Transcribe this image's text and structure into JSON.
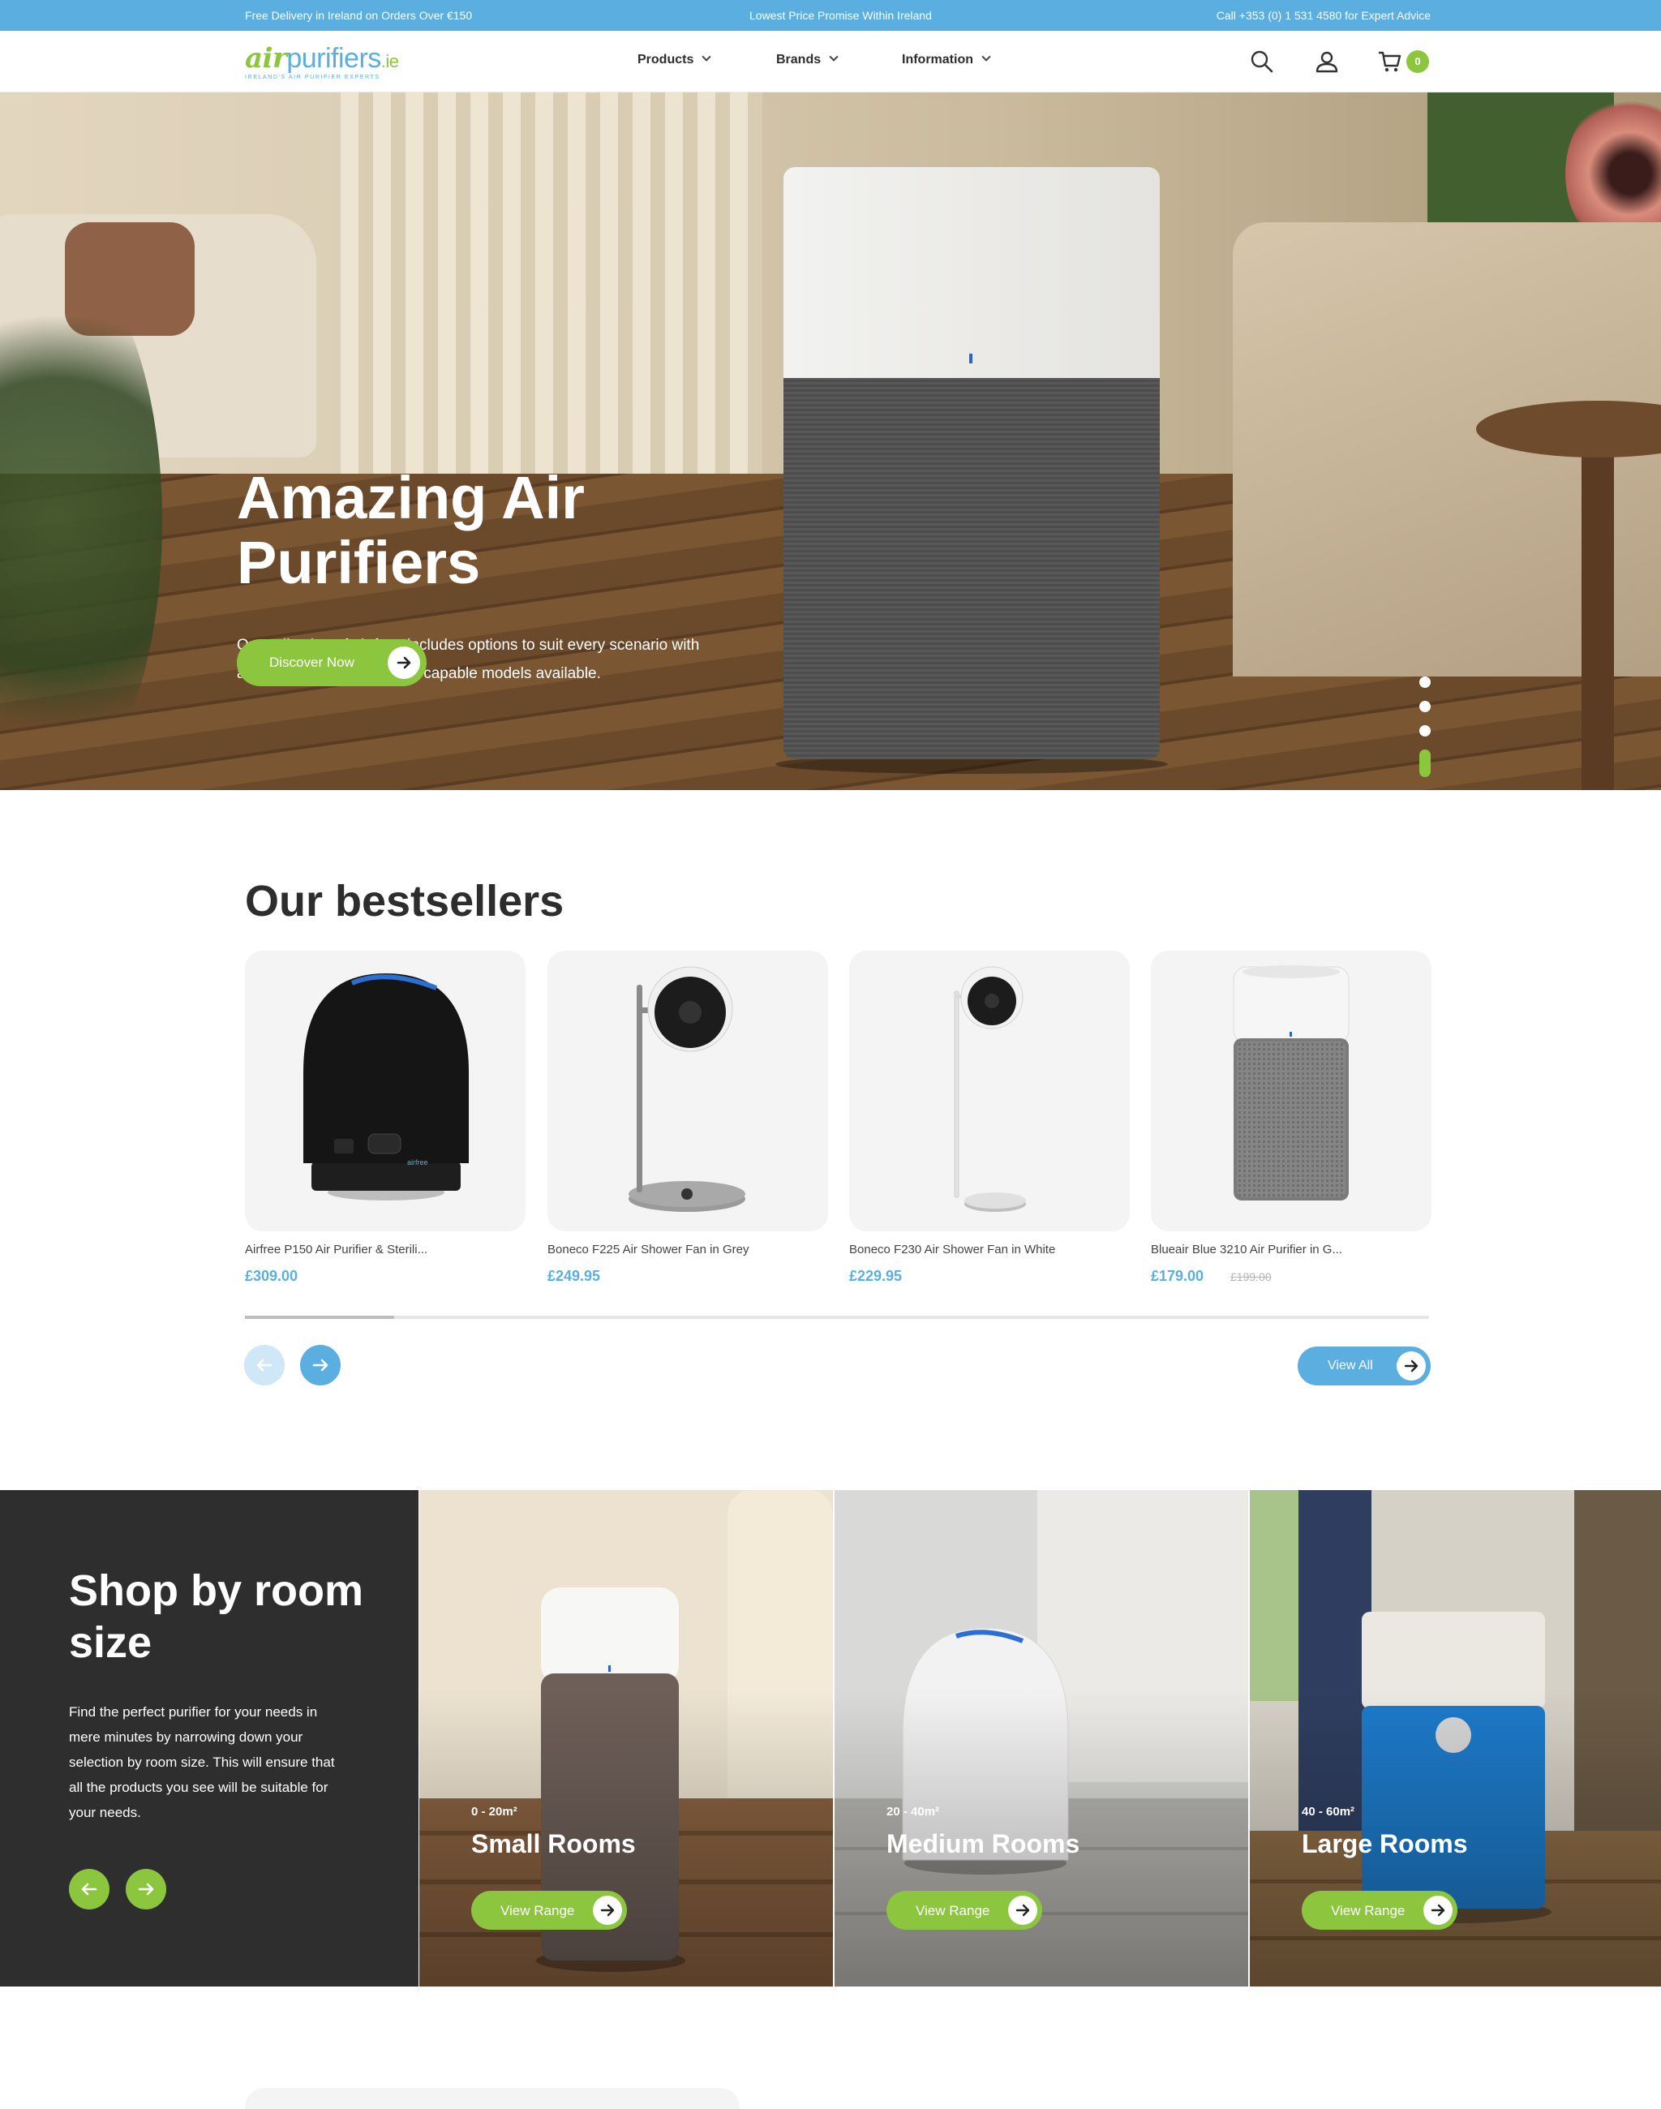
{
  "topbar": {
    "delivery": "Free Delivery in Ireland on Orders Over €150",
    "promise": "Lowest Price Promise Within Ireland",
    "phone": "Call +353 (0) 1 531 4580 for Expert Advice"
  },
  "header": {
    "logo_air": "air",
    "logo_purifiers": "purifiers",
    "logo_tld": ".ie",
    "logo_tagline": "IRELAND'S AIR PURIFIER EXPERTS",
    "nav": [
      {
        "label": "Products"
      },
      {
        "label": "Brands"
      },
      {
        "label": "Information"
      }
    ],
    "cart_count": "0",
    "icons": [
      "search-icon",
      "account-icon",
      "cart-icon"
    ]
  },
  "hero": {
    "title": "Amazing Air Purifiers",
    "text": "Our collection of air fans includes options to suit every scenario with a wide range of stylish and capable models available.",
    "button_label": "Discover Now",
    "slides": 4,
    "active_slide": 4
  },
  "bestsellers": {
    "title": "Our bestsellers",
    "products": [
      {
        "name": "Airfree P150 Air Purifier & Sterili...",
        "price": "£309.00",
        "old_price": ""
      },
      {
        "name": "Boneco F225 Air Shower Fan in Grey",
        "price": "£249.95",
        "old_price": ""
      },
      {
        "name": "Boneco F230 Air Shower Fan in White",
        "price": "£229.95",
        "old_price": ""
      },
      {
        "name": "Blueair Blue 3210 Air Purifier in G...",
        "price": "£179.00",
        "old_price": "£199.00"
      }
    ],
    "view_all_label": "View All",
    "scroll_position": 0.13
  },
  "room_size": {
    "title": "Shop by room size",
    "text": "Find the perfect purifier for your needs in mere minutes by narrowing down your selection by room size. This will ensure that all the products you see will be suitable for your needs.",
    "rooms": [
      {
        "range": "0 - 20m²",
        "title": "Small Rooms",
        "button": "View Range"
      },
      {
        "range": "20 - 40m²",
        "title": "Medium Rooms",
        "button": "View Range"
      },
      {
        "range": "40 - 60m²",
        "title": "Large Rooms",
        "button": "View Range"
      }
    ]
  },
  "colors": {
    "brand_blue": "#5aaee0",
    "brand_green": "#8cc63f",
    "dark_panel": "#2e2e2e"
  }
}
